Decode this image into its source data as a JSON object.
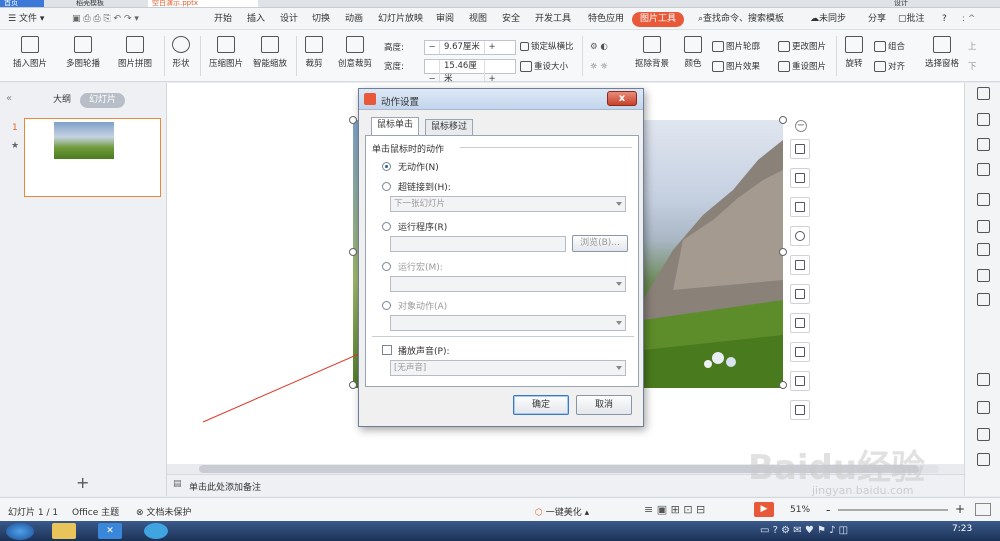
{
  "tabstrip": {
    "home": "首页",
    "template": "稻壳模板",
    "doc": "空白演示.pptx",
    "design": "设计"
  },
  "menu": {
    "file": "文件",
    "items": [
      "开始",
      "插入",
      "设计",
      "切换",
      "动画",
      "幻灯片放映",
      "审阅",
      "视图",
      "安全",
      "开发工具",
      "特色应用",
      "图片工具"
    ],
    "search": "查找命令、搜索模板",
    "sync": "未同步",
    "share": "分享",
    "comment": "批注",
    "help": "?"
  },
  "ribbon": {
    "insert_pic": "插入图片",
    "carousel": "多图轮播",
    "collage": "图片拼图",
    "shape": "形状",
    "compress": "压缩图片",
    "smart_zoom": "智能缩放",
    "crop": "裁剪",
    "creative_crop": "创意裁剪",
    "height_label": "高度:",
    "height_value": "9.67厘米",
    "width_label": "宽度:",
    "width_value": "15.46厘米",
    "lock_ratio": "锁定纵横比",
    "reset_size": "重设大小",
    "remove_bg": "抠除背景",
    "color": "颜色",
    "pic_outline": "图片轮廓",
    "pic_effect": "图片效果",
    "change_pic": "更改图片",
    "reset_pic": "重设图片",
    "rotate": "旋转",
    "group": "组合",
    "align": "对齐",
    "select_pane": "选择窗格",
    "up": "上",
    "down": "下"
  },
  "leftpanel": {
    "outline": "大纲",
    "slides": "幻灯片",
    "slide_num": "1",
    "add": "+",
    "collapse": "«"
  },
  "notes": {
    "placeholder": "单击此处添加备注"
  },
  "status": {
    "slide": "幻灯片 1 / 1",
    "theme": "Office 主题",
    "protect": "文档未保护",
    "beautify": "一键美化",
    "zoom": "51%",
    "minus": "-",
    "plus": "+"
  },
  "taskbar": {
    "time": "7:23"
  },
  "dialog": {
    "title": "动作设置",
    "close": "x",
    "tab_click": "鼠标单击",
    "tab_hover": "鼠标移过",
    "group_label": "单击鼠标时的动作",
    "opt_none": "无动作(N)",
    "opt_link": "超链接到(H):",
    "link_value": "下一张幻灯片",
    "opt_run": "运行程序(R)",
    "browse": "浏览(B)...",
    "opt_macro": "运行宏(M):",
    "opt_object": "对象动作(A)",
    "play_sound": "播放声音(P):",
    "sound_value": "[无声音]",
    "ok": "确定",
    "cancel": "取消"
  },
  "watermark": {
    "brand": "Baidu经验",
    "url": "jingyan.baidu.com"
  },
  "colors": {
    "accent": "#e8593a",
    "dialog_border": "#6d7f96",
    "arrow": "#e03a2a"
  }
}
